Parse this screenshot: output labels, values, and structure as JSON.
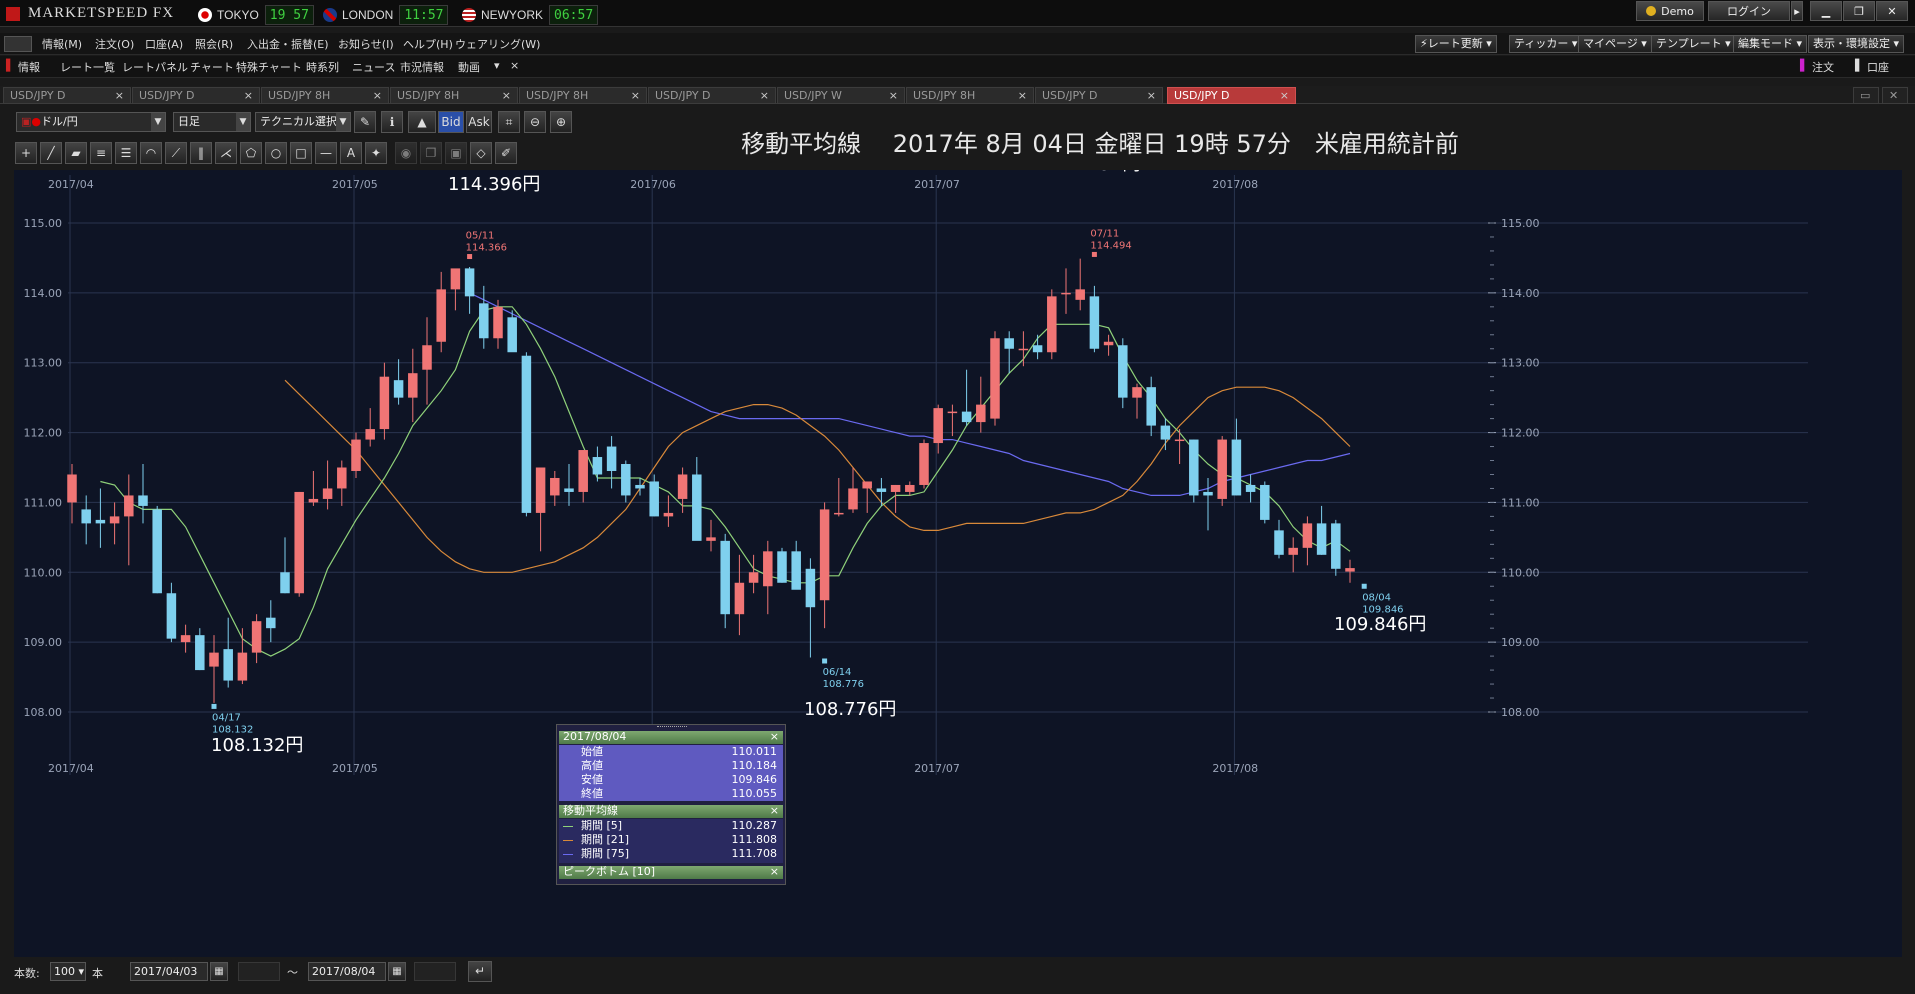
{
  "app": {
    "logo_text": "MARKETSPEED FX",
    "cities": [
      {
        "name": "TOKYO",
        "time": "19 57"
      },
      {
        "name": "LONDON",
        "time": "11:57"
      },
      {
        "name": "NEWYORK",
        "time": "06:57"
      }
    ],
    "demo_label": "Demo",
    "login_label": "ログイン"
  },
  "menu": {
    "items": [
      "情報(M)",
      "注文(O)",
      "口座(A)",
      "照会(R)",
      "入出金・振替(E)",
      "お知らせ(I)",
      "ヘルプ(H)",
      "ウェアリング(W)"
    ],
    "right_buttons": [
      "レート更新",
      "ティッカー",
      "マイページ",
      "テンプレート",
      "編集モード",
      "表示・環境設定"
    ]
  },
  "subbar": {
    "items": [
      "情報",
      "レート一覧",
      "レートパネル",
      "チャート",
      "特殊チャート",
      "時系列",
      "ニュース",
      "市況情報",
      "動画"
    ],
    "right_items": [
      "注文",
      "口座"
    ]
  },
  "tabs": [
    {
      "label": "USD/JPY D",
      "active": false
    },
    {
      "label": "USD/JPY D",
      "active": false
    },
    {
      "label": "USD/JPY 8H",
      "active": false
    },
    {
      "label": "USD/JPY 8H",
      "active": false
    },
    {
      "label": "USD/JPY 8H",
      "active": false
    },
    {
      "label": "USD/JPY D",
      "active": false
    },
    {
      "label": "USD/JPY W",
      "active": false
    },
    {
      "label": "USD/JPY 8H",
      "active": false
    },
    {
      "label": "USD/JPY D",
      "active": false
    },
    {
      "label": "USD/JPY D",
      "active": true
    }
  ],
  "chart_toolbar": {
    "currency": "ドル/円",
    "timeframe": "日足",
    "tech_select": "テクニカル選択",
    "bid": "Bid",
    "ask": "Ask"
  },
  "chart_title": "移動平均線　 2017年 8月 04日 金曜日 19時 57分　米雇用統計前",
  "bottom": {
    "count_label": "本数:",
    "count_value": "100",
    "unit": "本",
    "start_date": "2017/04/03",
    "end_date": "2017/08/04",
    "tilde": "〜"
  },
  "info_panel": {
    "date_header": "2017/08/04",
    "ohlc": [
      {
        "label": "始値",
        "value": "110.011"
      },
      {
        "label": "高値",
        "value": "110.184"
      },
      {
        "label": "安値",
        "value": "109.846"
      },
      {
        "label": "終値",
        "value": "110.055"
      }
    ],
    "ma_header": "移動平均線",
    "ma": [
      {
        "label": "期間 [5]",
        "value": "110.287"
      },
      {
        "label": "期間 [21]",
        "value": "111.808"
      },
      {
        "label": "期間 [75]",
        "value": "111.708"
      }
    ],
    "peak_header": "ピークボトム [10]"
  },
  "chart_data": {
    "type": "candlestick",
    "ylim": [
      107.6,
      115.2
    ],
    "yticks": [
      "115.00",
      "114.00",
      "113.00",
      "112.00",
      "111.00",
      "110.00",
      "109.00",
      "108.00"
    ],
    "xticks": [
      "2017/04",
      "2017/05",
      "2017/06",
      "2017/07",
      "2017/08"
    ],
    "candles": [
      {
        "o": 111.0,
        "h": 111.55,
        "l": 110.7,
        "c": 111.4
      },
      {
        "o": 110.9,
        "h": 111.1,
        "l": 110.4,
        "c": 110.7
      },
      {
        "o": 110.75,
        "h": 111.2,
        "l": 110.35,
        "c": 110.7
      },
      {
        "o": 110.7,
        "h": 111.0,
        "l": 110.4,
        "c": 110.8
      },
      {
        "o": 110.8,
        "h": 111.4,
        "l": 110.1,
        "c": 111.1
      },
      {
        "o": 111.1,
        "h": 111.55,
        "l": 110.7,
        "c": 110.95
      },
      {
        "o": 110.9,
        "h": 110.95,
        "l": 109.7,
        "c": 109.7
      },
      {
        "o": 109.7,
        "h": 109.85,
        "l": 109.0,
        "c": 109.05
      },
      {
        "o": 109.0,
        "h": 109.25,
        "l": 108.85,
        "c": 109.1
      },
      {
        "o": 109.1,
        "h": 109.2,
        "l": 108.6,
        "c": 108.6
      },
      {
        "o": 108.65,
        "h": 109.1,
        "l": 108.13,
        "c": 108.85
      },
      {
        "o": 108.9,
        "h": 109.35,
        "l": 108.35,
        "c": 108.45
      },
      {
        "o": 108.45,
        "h": 109.2,
        "l": 108.4,
        "c": 108.85
      },
      {
        "o": 108.85,
        "h": 109.4,
        "l": 108.7,
        "c": 109.3
      },
      {
        "o": 109.35,
        "h": 109.6,
        "l": 109.0,
        "c": 109.2
      },
      {
        "o": 110.0,
        "h": 110.5,
        "l": 109.7,
        "c": 109.7
      },
      {
        "o": 109.7,
        "h": 111.15,
        "l": 109.65,
        "c": 111.15
      },
      {
        "o": 111.0,
        "h": 111.45,
        "l": 110.95,
        "c": 111.05
      },
      {
        "o": 111.05,
        "h": 111.6,
        "l": 110.9,
        "c": 111.2
      },
      {
        "o": 111.2,
        "h": 111.6,
        "l": 110.95,
        "c": 111.5
      },
      {
        "o": 111.45,
        "h": 112.0,
        "l": 111.35,
        "c": 111.9
      },
      {
        "o": 111.9,
        "h": 112.35,
        "l": 111.8,
        "c": 112.05
      },
      {
        "o": 112.05,
        "h": 113.0,
        "l": 111.9,
        "c": 112.8
      },
      {
        "o": 112.75,
        "h": 113.05,
        "l": 112.4,
        "c": 112.5
      },
      {
        "o": 112.5,
        "h": 113.2,
        "l": 112.15,
        "c": 112.85
      },
      {
        "o": 112.9,
        "h": 113.65,
        "l": 112.4,
        "c": 113.25
      },
      {
        "o": 113.3,
        "h": 114.3,
        "l": 113.15,
        "c": 114.05
      },
      {
        "o": 114.05,
        "h": 114.3,
        "l": 113.75,
        "c": 114.35
      },
      {
        "o": 114.35,
        "h": 114.37,
        "l": 113.7,
        "c": 113.95
      },
      {
        "o": 113.85,
        "h": 114.1,
        "l": 113.2,
        "c": 113.35
      },
      {
        "o": 113.35,
        "h": 113.9,
        "l": 113.2,
        "c": 113.8
      },
      {
        "o": 113.65,
        "h": 113.75,
        "l": 113.2,
        "c": 113.15
      },
      {
        "o": 113.1,
        "h": 113.15,
        "l": 110.8,
        "c": 110.85
      },
      {
        "o": 110.85,
        "h": 111.3,
        "l": 110.3,
        "c": 111.5
      },
      {
        "o": 111.1,
        "h": 111.45,
        "l": 110.95,
        "c": 111.35
      },
      {
        "o": 111.2,
        "h": 111.55,
        "l": 110.95,
        "c": 111.15
      },
      {
        "o": 111.15,
        "h": 111.75,
        "l": 111.0,
        "c": 111.75
      },
      {
        "o": 111.65,
        "h": 111.8,
        "l": 111.3,
        "c": 111.4
      },
      {
        "o": 111.8,
        "h": 111.95,
        "l": 111.2,
        "c": 111.45
      },
      {
        "o": 111.55,
        "h": 111.6,
        "l": 111.0,
        "c": 111.1
      },
      {
        "o": 111.25,
        "h": 111.35,
        "l": 111.1,
        "c": 111.2
      },
      {
        "o": 111.3,
        "h": 111.4,
        "l": 110.8,
        "c": 110.8
      },
      {
        "o": 110.8,
        "h": 111.1,
        "l": 110.65,
        "c": 110.85
      },
      {
        "o": 111.05,
        "h": 111.5,
        "l": 110.85,
        "c": 111.4
      },
      {
        "o": 111.4,
        "h": 111.65,
        "l": 110.95,
        "c": 110.45
      },
      {
        "o": 110.45,
        "h": 110.75,
        "l": 110.3,
        "c": 110.5
      },
      {
        "o": 110.45,
        "h": 110.55,
        "l": 109.2,
        "c": 109.4
      },
      {
        "o": 109.4,
        "h": 110.25,
        "l": 109.1,
        "c": 109.85
      },
      {
        "o": 109.85,
        "h": 110.25,
        "l": 109.7,
        "c": 110.0
      },
      {
        "o": 109.8,
        "h": 110.45,
        "l": 109.4,
        "c": 110.3
      },
      {
        "o": 110.3,
        "h": 110.35,
        "l": 109.85,
        "c": 109.85
      },
      {
        "o": 110.3,
        "h": 110.45,
        "l": 109.95,
        "c": 109.75
      },
      {
        "o": 110.05,
        "h": 110.2,
        "l": 108.78,
        "c": 109.5
      },
      {
        "o": 109.6,
        "h": 111.0,
        "l": 109.2,
        "c": 110.9
      },
      {
        "o": 110.85,
        "h": 111.35,
        "l": 110.8,
        "c": 110.85
      },
      {
        "o": 110.9,
        "h": 111.5,
        "l": 110.85,
        "c": 111.2
      },
      {
        "o": 111.2,
        "h": 111.3,
        "l": 110.85,
        "c": 111.3
      },
      {
        "o": 111.2,
        "h": 111.35,
        "l": 110.95,
        "c": 111.15
      },
      {
        "o": 111.15,
        "h": 111.25,
        "l": 110.85,
        "c": 111.25
      },
      {
        "o": 111.15,
        "h": 111.3,
        "l": 111.1,
        "c": 111.25
      },
      {
        "o": 111.25,
        "h": 111.9,
        "l": 111.2,
        "c": 111.85
      },
      {
        "o": 111.85,
        "h": 112.4,
        "l": 111.7,
        "c": 112.35
      },
      {
        "o": 112.3,
        "h": 112.4,
        "l": 111.95,
        "c": 112.3
      },
      {
        "o": 112.3,
        "h": 112.9,
        "l": 112.1,
        "c": 112.15
      },
      {
        "o": 112.15,
        "h": 112.8,
        "l": 112.0,
        "c": 112.4
      },
      {
        "o": 112.2,
        "h": 113.45,
        "l": 112.1,
        "c": 113.35
      },
      {
        "o": 113.35,
        "h": 113.45,
        "l": 112.85,
        "c": 113.2
      },
      {
        "o": 113.2,
        "h": 113.45,
        "l": 112.95,
        "c": 113.2
      },
      {
        "o": 113.25,
        "h": 113.4,
        "l": 113.05,
        "c": 113.15
      },
      {
        "o": 113.15,
        "h": 114.05,
        "l": 113.05,
        "c": 113.95
      },
      {
        "o": 114.0,
        "h": 114.35,
        "l": 113.7,
        "c": 114.0
      },
      {
        "o": 113.9,
        "h": 114.49,
        "l": 113.75,
        "c": 114.05
      },
      {
        "o": 113.95,
        "h": 114.1,
        "l": 113.15,
        "c": 113.2
      },
      {
        "o": 113.25,
        "h": 113.4,
        "l": 113.1,
        "c": 113.3
      },
      {
        "o": 113.25,
        "h": 113.35,
        "l": 112.35,
        "c": 112.5
      },
      {
        "o": 112.5,
        "h": 112.7,
        "l": 112.2,
        "c": 112.65
      },
      {
        "o": 112.65,
        "h": 112.8,
        "l": 111.95,
        "c": 112.1
      },
      {
        "o": 112.1,
        "h": 112.2,
        "l": 111.75,
        "c": 111.9
      },
      {
        "o": 111.9,
        "h": 112.05,
        "l": 111.55,
        "c": 111.9
      },
      {
        "o": 111.9,
        "h": 111.9,
        "l": 111.0,
        "c": 111.1
      },
      {
        "o": 111.15,
        "h": 111.35,
        "l": 110.6,
        "c": 111.1
      },
      {
        "o": 111.05,
        "h": 111.95,
        "l": 110.95,
        "c": 111.9
      },
      {
        "o": 111.9,
        "h": 112.2,
        "l": 111.1,
        "c": 111.1
      },
      {
        "o": 111.25,
        "h": 111.4,
        "l": 111.0,
        "c": 111.15
      },
      {
        "o": 111.25,
        "h": 111.3,
        "l": 110.7,
        "c": 110.75
      },
      {
        "o": 110.6,
        "h": 110.75,
        "l": 110.2,
        "c": 110.25
      },
      {
        "o": 110.25,
        "h": 110.5,
        "l": 110.0,
        "c": 110.35
      },
      {
        "o": 110.35,
        "h": 110.8,
        "l": 110.1,
        "c": 110.7
      },
      {
        "o": 110.7,
        "h": 110.95,
        "l": 110.25,
        "c": 110.25
      },
      {
        "o": 110.7,
        "h": 110.75,
        "l": 109.95,
        "c": 110.05
      },
      {
        "o": 110.01,
        "h": 110.18,
        "l": 109.85,
        "c": 110.06
      }
    ],
    "ma5_color": "#8fd17a",
    "ma21_color": "#d8893a",
    "ma75_color": "#6a6af0",
    "ma5": [
      111.3,
      111.25,
      111.0,
      110.9,
      110.9,
      110.9,
      110.65,
      110.25,
      109.85,
      109.45,
      109.05,
      108.9,
      108.8,
      108.9,
      109.05,
      109.5,
      110.05,
      110.4,
      110.75,
      111.05,
      111.35,
      111.7,
      112.1,
      112.35,
      112.6,
      112.9,
      113.45,
      113.75,
      113.8,
      113.8,
      113.55,
      113.2,
      112.8,
      112.3,
      111.8,
      111.35,
      111.35,
      111.35,
      111.35,
      111.25,
      111.15,
      110.95,
      110.95,
      110.9,
      110.65,
      110.35,
      110.05,
      109.95,
      109.9,
      109.85,
      109.85,
      109.95,
      109.95,
      110.35,
      110.7,
      110.95,
      111.1,
      111.1,
      111.15,
      111.45,
      111.75,
      112.1,
      112.35,
      112.6,
      112.85,
      113.05,
      113.35,
      113.55,
      113.55,
      113.55,
      113.55,
      113.5,
      113.1,
      112.75,
      112.5,
      112.2,
      112.0,
      111.75,
      111.55,
      111.4,
      111.35,
      111.25,
      111.15,
      110.95,
      110.65,
      110.45,
      110.35,
      110.45,
      110.3
    ],
    "ma21": [
      112.75,
      112.55,
      112.35,
      112.15,
      111.95,
      111.75,
      111.5,
      111.25,
      111.0,
      110.75,
      110.5,
      110.3,
      110.15,
      110.05,
      110.0,
      110.0,
      110.0,
      110.05,
      110.1,
      110.15,
      110.25,
      110.35,
      110.5,
      110.7,
      110.9,
      111.2,
      111.5,
      111.8,
      112.0,
      112.1,
      112.2,
      112.3,
      112.35,
      112.4,
      112.4,
      112.35,
      112.25,
      112.1,
      111.95,
      111.75,
      111.5,
      111.25,
      111.0,
      110.8,
      110.65,
      110.6,
      110.6,
      110.65,
      110.7,
      110.7,
      110.7,
      110.7,
      110.7,
      110.75,
      110.8,
      110.85,
      110.85,
      110.9,
      111.0,
      111.1,
      111.3,
      111.55,
      111.85,
      112.1,
      112.3,
      112.5,
      112.6,
      112.65,
      112.65,
      112.65,
      112.6,
      112.5,
      112.35,
      112.2,
      112.0,
      111.8
    ],
    "ma75": [
      114.0,
      113.9,
      113.8,
      113.7,
      113.6,
      113.5,
      113.4,
      113.3,
      113.2,
      113.1,
      113.0,
      112.9,
      112.8,
      112.7,
      112.6,
      112.5,
      112.4,
      112.3,
      112.25,
      112.2,
      112.2,
      112.2,
      112.2,
      112.2,
      112.2,
      112.2,
      112.2,
      112.15,
      112.1,
      112.05,
      112.0,
      111.95,
      111.95,
      111.9,
      111.9,
      111.85,
      111.8,
      111.75,
      111.7,
      111.6,
      111.55,
      111.5,
      111.45,
      111.4,
      111.35,
      111.3,
      111.2,
      111.15,
      111.1,
      111.1,
      111.1,
      111.15,
      111.2,
      111.3,
      111.35,
      111.4,
      111.45,
      111.5,
      111.55,
      111.6,
      111.6,
      111.65,
      111.7
    ]
  },
  "annotations": {
    "high1_big": "114.396円",
    "high1_date": "05/11",
    "high1_val": "114.366",
    "high2_big": "114.494円",
    "high2_date": "07/11",
    "high2_val": "114.494",
    "low1_big": "108.132円",
    "low1_date": "04/17",
    "low1_val": "108.132",
    "low2_big": "108.776円",
    "low2_date": "06/14",
    "low2_val": "108.776",
    "last_big": "109.846円",
    "last_date": "08/04",
    "last_val": "109.846"
  },
  "colors": {
    "bull": "#f07575",
    "bear": "#7fd0ee",
    "bg": "#0e1425"
  }
}
